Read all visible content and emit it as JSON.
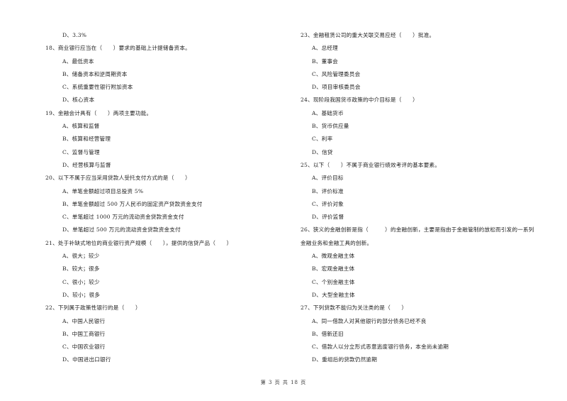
{
  "left_column": {
    "lines": [
      {
        "type": "option",
        "text": "D、3.3%"
      },
      {
        "type": "question",
        "text": "18、商业银行应当在（　　）要求的基础上计提储备资本。"
      },
      {
        "type": "option",
        "text": "A、最低资本"
      },
      {
        "type": "option",
        "text": "B、储备资本和逆周期资本"
      },
      {
        "type": "option",
        "text": "C、系统重要性银行附加资本"
      },
      {
        "type": "option",
        "text": "D、核心资本"
      },
      {
        "type": "question",
        "text": "19、金融会计具有（　　）两项主要功能。"
      },
      {
        "type": "option",
        "text": "A、核算和监督"
      },
      {
        "type": "option",
        "text": "B、核算和经营管理"
      },
      {
        "type": "option",
        "text": "C、监督与管理"
      },
      {
        "type": "option",
        "text": "D、经营核算与监督"
      },
      {
        "type": "question",
        "text": "20、以下不属于应当采用贷款人受托支付方式的是（　　）"
      },
      {
        "type": "option",
        "text": "A、单笔金额超过项目总投资 5%"
      },
      {
        "type": "option",
        "text": "B、单笔金额超过 500 万人民币的固定资产贷款资金支付"
      },
      {
        "type": "option",
        "text": "C、单笔超过 1000 万元的流动资金贷款资金支付"
      },
      {
        "type": "option",
        "text": "D、单笔超过 500 万元的流动资金贷款资金支付"
      },
      {
        "type": "question",
        "text": "21、处于补缺式地位的商业银行资产规模（　　），提供的信贷产品（　　）"
      },
      {
        "type": "option",
        "text": "A、很大；较少"
      },
      {
        "type": "option",
        "text": "B、较大；很多"
      },
      {
        "type": "option",
        "text": "C、很小；较少"
      },
      {
        "type": "option",
        "text": "D、较小；很多"
      },
      {
        "type": "question",
        "text": "22、下列属于政策性银行的是（　　）"
      },
      {
        "type": "option",
        "text": "A、中国人民银行"
      },
      {
        "type": "option",
        "text": "B、中国工商银行"
      },
      {
        "type": "option",
        "text": "C、中国农业银行"
      },
      {
        "type": "option",
        "text": "D、中国进出口银行"
      }
    ]
  },
  "right_column": {
    "lines": [
      {
        "type": "question",
        "text": "23、金融租赁公司的重大关联交易应经（　　）批准。"
      },
      {
        "type": "option",
        "text": "A、总经理"
      },
      {
        "type": "option",
        "text": "B、董事会"
      },
      {
        "type": "option",
        "text": "C、风险管理委员会"
      },
      {
        "type": "option",
        "text": "D、项目审核委员会"
      },
      {
        "type": "question",
        "text": "24、现阶段我国货币政策的中介目标是（　　）"
      },
      {
        "type": "option",
        "text": "A、基础货币"
      },
      {
        "type": "option",
        "text": "B、货币供应量"
      },
      {
        "type": "option",
        "text": "C、利率"
      },
      {
        "type": "option",
        "text": "D、信贷"
      },
      {
        "type": "question",
        "text": "25、以下（　　）不属于商业银行绩效考评的基本要素。"
      },
      {
        "type": "option",
        "text": "A、评价目标"
      },
      {
        "type": "option",
        "text": "B、评价标准"
      },
      {
        "type": "option",
        "text": "C、评价对象"
      },
      {
        "type": "option",
        "text": "D、评价监督"
      },
      {
        "type": "question",
        "text": "26、狭义的金融创新是指（　　　）的金融创新，主要是指由于金融管制的放松而引发的一系列"
      },
      {
        "type": "continuation",
        "text": "金融业务和金融工具的创新。"
      },
      {
        "type": "option",
        "text": "A、微观金融主体"
      },
      {
        "type": "option",
        "text": "B、宏观金融主体"
      },
      {
        "type": "option",
        "text": "C、个别金融主体"
      },
      {
        "type": "option",
        "text": "D、大型金融主体"
      },
      {
        "type": "question",
        "text": "27、下列贷款不能归为关注类的是（　　）"
      },
      {
        "type": "option",
        "text": "A、同一借款人对其他银行的部分债务已经不良"
      },
      {
        "type": "option",
        "text": "B、借新还旧"
      },
      {
        "type": "option",
        "text": "C、借款人以分立形式恶意逃废银行债务，本金尚未逾期"
      },
      {
        "type": "option",
        "text": "D、重组后的贷款仍然逾期"
      }
    ]
  },
  "footer": {
    "page_label": "第 3 页 共 18 页"
  }
}
